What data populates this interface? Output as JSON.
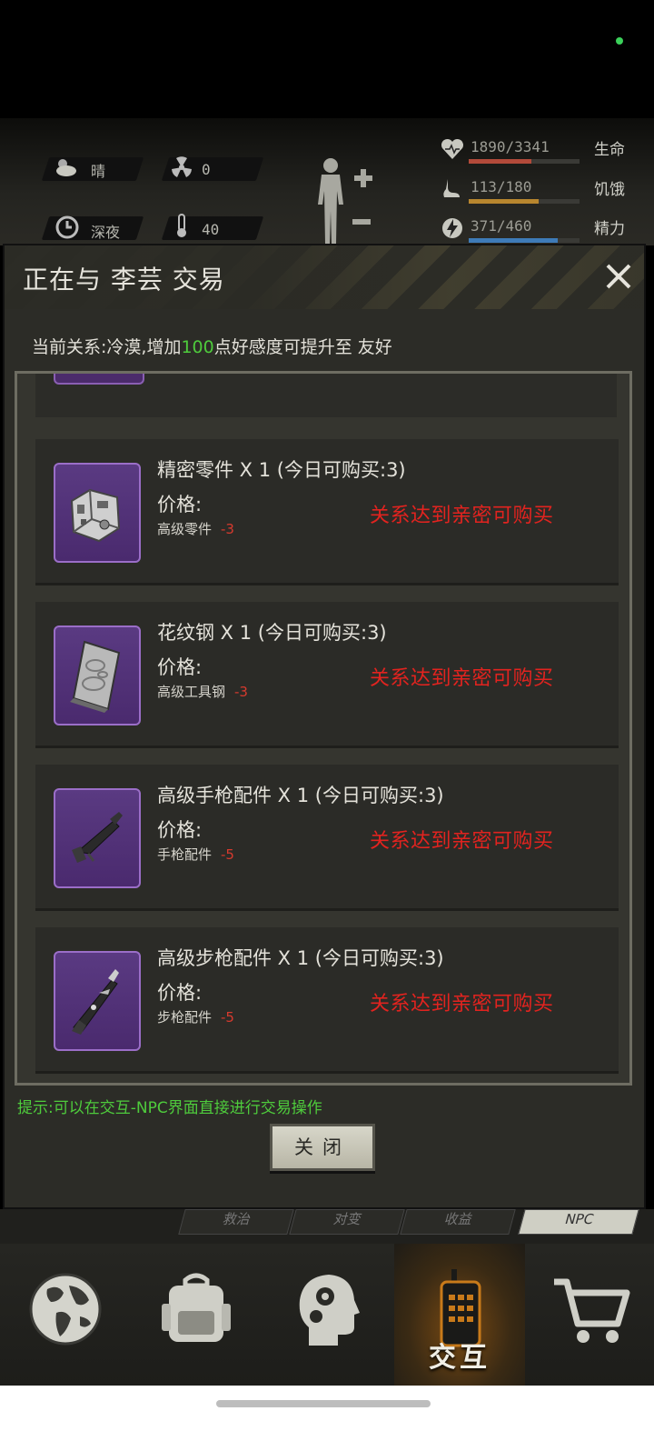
{
  "hud": {
    "weather": "晴",
    "radiation": "0",
    "time_of_day": "深夜",
    "temperature": "40",
    "stats": [
      {
        "label": "生命",
        "value": "1890/3341",
        "ratio": 0.566,
        "color": "#b24a3a"
      },
      {
        "label": "饥饿",
        "value": "113/180",
        "ratio": 0.628,
        "color": "#b8862e"
      },
      {
        "label": "精力",
        "value": "371/460",
        "ratio": 0.807,
        "color": "#3e7bb8"
      }
    ]
  },
  "dialog": {
    "title": "正在与 李芸 交易",
    "relation_prefix": "当前关系:冷漠,增加",
    "relation_amount": "100",
    "relation_suffix": "点好感度可提升至 友好",
    "items": [
      {
        "name": "精密零件 X 1",
        "limit": "(今日可购买:3)",
        "price_label": "价格:",
        "cost_item": "高级零件",
        "cost_amount": "-3",
        "lock_message": "关系达到亲密可购买",
        "icon": "precision-parts-icon"
      },
      {
        "name": "花纹钢 X 1",
        "limit": "(今日可购买:3)",
        "price_label": "价格:",
        "cost_item": "高级工具钢",
        "cost_amount": "-3",
        "lock_message": "关系达到亲密可购买",
        "icon": "damascus-steel-icon"
      },
      {
        "name": "高级手枪配件 X 1",
        "limit": "(今日可购买:3)",
        "price_label": "价格:",
        "cost_item": "手枪配件",
        "cost_amount": "-5",
        "lock_message": "关系达到亲密可购买",
        "icon": "pistol-parts-icon"
      },
      {
        "name": "高级步枪配件 X 1",
        "limit": "(今日可购买:3)",
        "price_label": "价格:",
        "cost_item": "步枪配件",
        "cost_amount": "-5",
        "lock_message": "关系达到亲密可购买",
        "icon": "rifle-parts-icon"
      }
    ],
    "hint": "提示:可以在交互-NPC界面直接进行交易操作",
    "close_label": "关闭"
  },
  "behind_tabs": [
    "救治",
    "对变",
    "收益",
    "NPC"
  ],
  "bottom_nav": {
    "items": [
      {
        "icon": "globe-icon",
        "label": ""
      },
      {
        "icon": "backpack-icon",
        "label": ""
      },
      {
        "icon": "head-gear-icon",
        "label": ""
      },
      {
        "icon": "radio-icon",
        "label": "交互"
      },
      {
        "icon": "cart-icon",
        "label": ""
      }
    ]
  }
}
